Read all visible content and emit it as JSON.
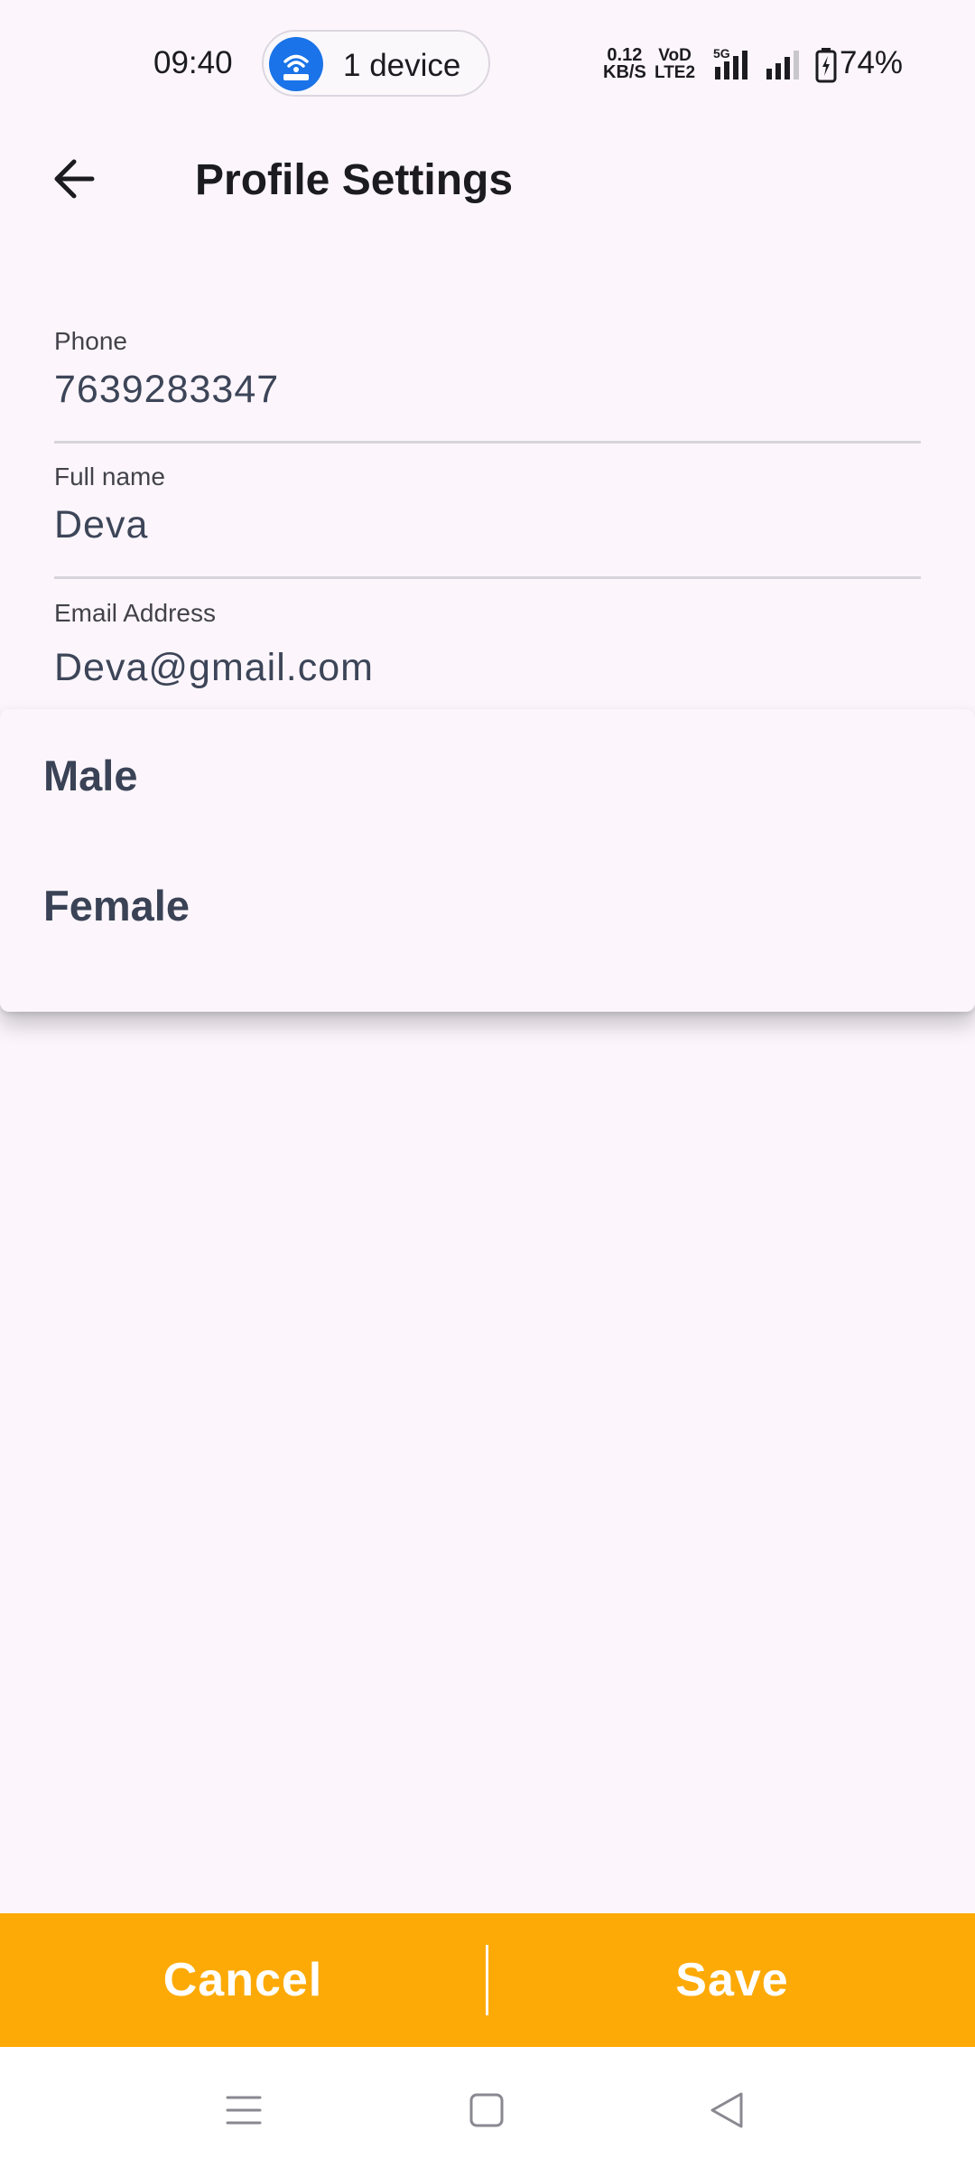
{
  "status_bar": {
    "time": "09:40",
    "hotspot_text": "1 device",
    "net_speed_value": "0.12",
    "net_speed_unit": "KB/S",
    "volte_top": "VoD",
    "volte_bottom": "LTE2",
    "network_type": "5G",
    "battery": "74%"
  },
  "header": {
    "title": "Profile Settings",
    "back_icon": "arrow-left-icon"
  },
  "form": {
    "phone": {
      "label": "Phone",
      "value": "7639283347"
    },
    "full_name": {
      "label": "Full name",
      "value": "Deva"
    },
    "email": {
      "label": "Email Address",
      "value": "Deva@gmail.com"
    }
  },
  "gender_dropdown": {
    "options": [
      "Male",
      "Female"
    ]
  },
  "actions": {
    "cancel_label": "Cancel",
    "save_label": "Save"
  },
  "colors": {
    "accent": "#fdaa07",
    "background": "#fcf6fc",
    "text_value": "#3d4558"
  },
  "nav_bar": {
    "icons": [
      "menu-icon",
      "home-icon",
      "back-triangle-icon"
    ]
  }
}
